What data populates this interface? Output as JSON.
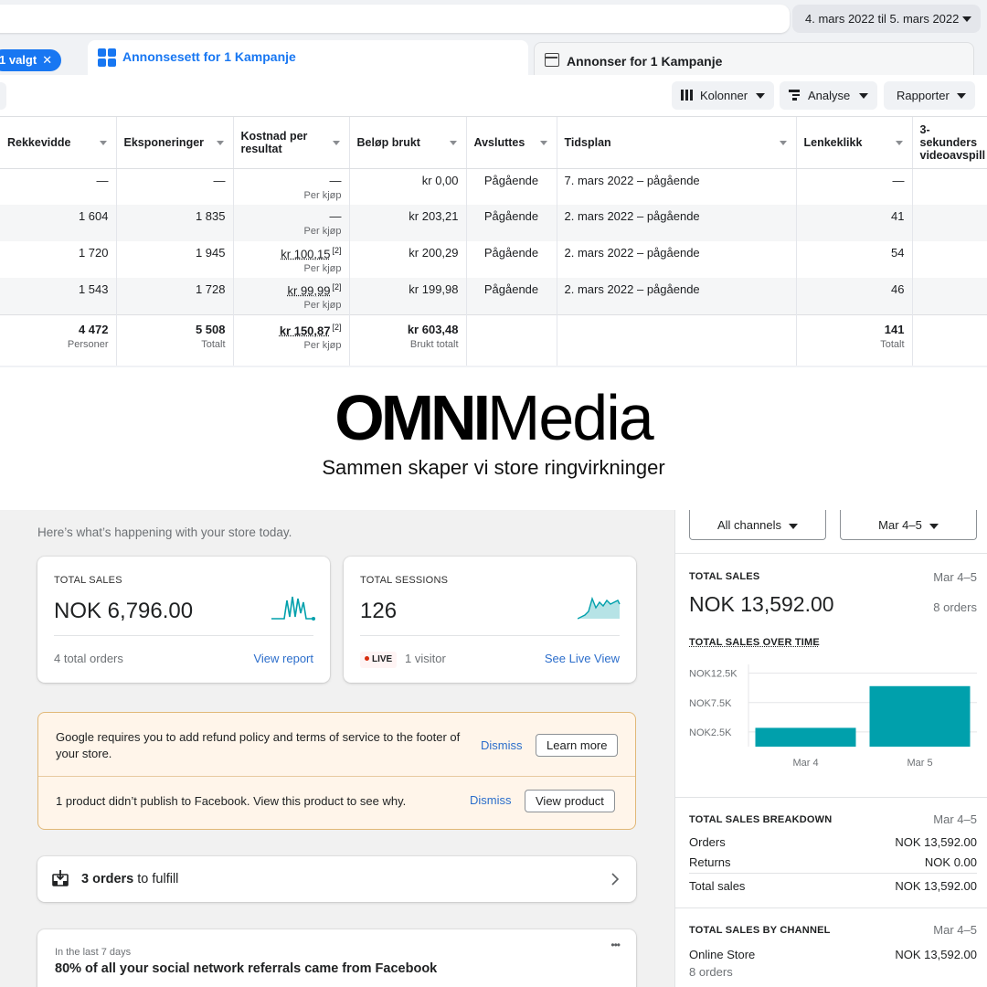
{
  "ads": {
    "date_range": "4. mars 2022 til 5. mars 2022",
    "selected_chip": "1 valgt",
    "tab_adsets": "Annonsesett for 1 Kampanje",
    "tab_ads": "Annonser for 1 Kampanje",
    "toolbar": {
      "columns": "Kolonner",
      "analysis": "Analyse",
      "reports": "Rapporter"
    },
    "headers": [
      "Rekkevidde",
      "Eksponeringer",
      "Kostnad per resultat",
      "Beløp brukt",
      "Avsluttes",
      "Tidsplan",
      "Lenkeklikk",
      "3-sekunders videoavspill"
    ],
    "rows": [
      {
        "reach": "—",
        "impr": "—",
        "cpr": "—",
        "cpr_sub": "Per kjøp",
        "spent": "kr 0,00",
        "ends": "Pågående",
        "schedule": "7. mars 2022 – pågående",
        "clicks": "—"
      },
      {
        "reach": "1 604",
        "impr": "1 835",
        "cpr": "—",
        "cpr_sub": "Per kjøp",
        "spent": "kr 203,21",
        "ends": "Pågående",
        "schedule": "2. mars 2022 – pågående",
        "clicks": "41"
      },
      {
        "reach": "1 720",
        "impr": "1 945",
        "cpr": "kr 100,15",
        "cpr_note": "[2]",
        "cpr_sub": "Per kjøp",
        "spent": "kr 200,29",
        "ends": "Pågående",
        "schedule": "2. mars 2022 – pågående",
        "clicks": "54"
      },
      {
        "reach": "1 543",
        "impr": "1 728",
        "cpr": "kr 99,99",
        "cpr_note": "[2]",
        "cpr_sub": "Per kjøp",
        "spent": "kr 199,98",
        "ends": "Pågående",
        "schedule": "2. mars 2022 – pågående",
        "clicks": "46"
      }
    ],
    "totals": {
      "reach": "4 472",
      "reach_sub": "Personer",
      "impr": "5 508",
      "impr_sub": "Totalt",
      "cpr": "kr 150,87",
      "cpr_note": "[2]",
      "cpr_sub": "Per kjøp",
      "spent": "kr 603,48",
      "spent_sub": "Brukt totalt",
      "clicks": "141",
      "clicks_sub": "Totalt"
    }
  },
  "brand": {
    "logo_bold": "OMNI",
    "logo_light": "Media",
    "tagline": "Sammen skaper vi store ringvirkninger"
  },
  "shop": {
    "intro": "Here’s what’s happening with your store today.",
    "sales_card": {
      "label": "TOTAL SALES",
      "value": "NOK 6,796.00",
      "footer": "4 total orders",
      "link": "View report"
    },
    "sessions_card": {
      "label": "TOTAL SESSIONS",
      "value": "126",
      "live": "LIVE",
      "visitors": "1 visitor",
      "link": "See Live View"
    },
    "banner": {
      "msg1": "Google requires you to add refund policy and terms of service to the footer of your store.",
      "dismiss1": "Dismiss",
      "action1": "Learn more",
      "msg2": "1 product didn’t publish to Facebook. View this product to see why.",
      "dismiss2": "Dismiss",
      "action2": "View product"
    },
    "orders": {
      "count": "3 orders",
      "suffix": "to fulfill"
    },
    "insight": {
      "kicker": "In the last 7 days",
      "title": "80% of all your social network referrals came from Facebook",
      "menu": "•••"
    },
    "side": {
      "channel_select": "All channels",
      "date_select": "Mar 4–5",
      "total_sales": {
        "label": "TOTAL SALES",
        "date": "Mar 4–5",
        "value": "NOK 13,592.00",
        "orders": "8 orders"
      },
      "chart_title": "TOTAL SALES OVER TIME",
      "breakdown": {
        "label": "TOTAL SALES BREAKDOWN",
        "date": "Mar 4–5",
        "rows": [
          {
            "k": "Orders",
            "v": "NOK 13,592.00"
          },
          {
            "k": "Returns",
            "v": "NOK 0.00"
          },
          {
            "k": "Total sales",
            "v": "NOK 13,592.00"
          }
        ]
      },
      "by_channel": {
        "label": "TOTAL SALES BY CHANNEL",
        "date": "Mar 4–5",
        "channel": "Online Store",
        "value": "NOK 13,592.00",
        "orders": "8 orders"
      }
    },
    "colors": {
      "accent": "#00a0ac",
      "link": "#2c6ecb",
      "fb_blue": "#1877f2"
    }
  },
  "chart_data": {
    "type": "bar",
    "title": "TOTAL SALES OVER TIME",
    "categories": [
      "Mar 4",
      "Mar 5"
    ],
    "values": [
      3200,
      10300
    ],
    "yticks": [
      "NOK2.5K",
      "NOK7.5K",
      "NOK12.5K"
    ],
    "ytick_values": [
      2500,
      7500,
      12500
    ],
    "ylim": [
      0,
      14000
    ],
    "grid": true,
    "color": "#00a0ac"
  }
}
